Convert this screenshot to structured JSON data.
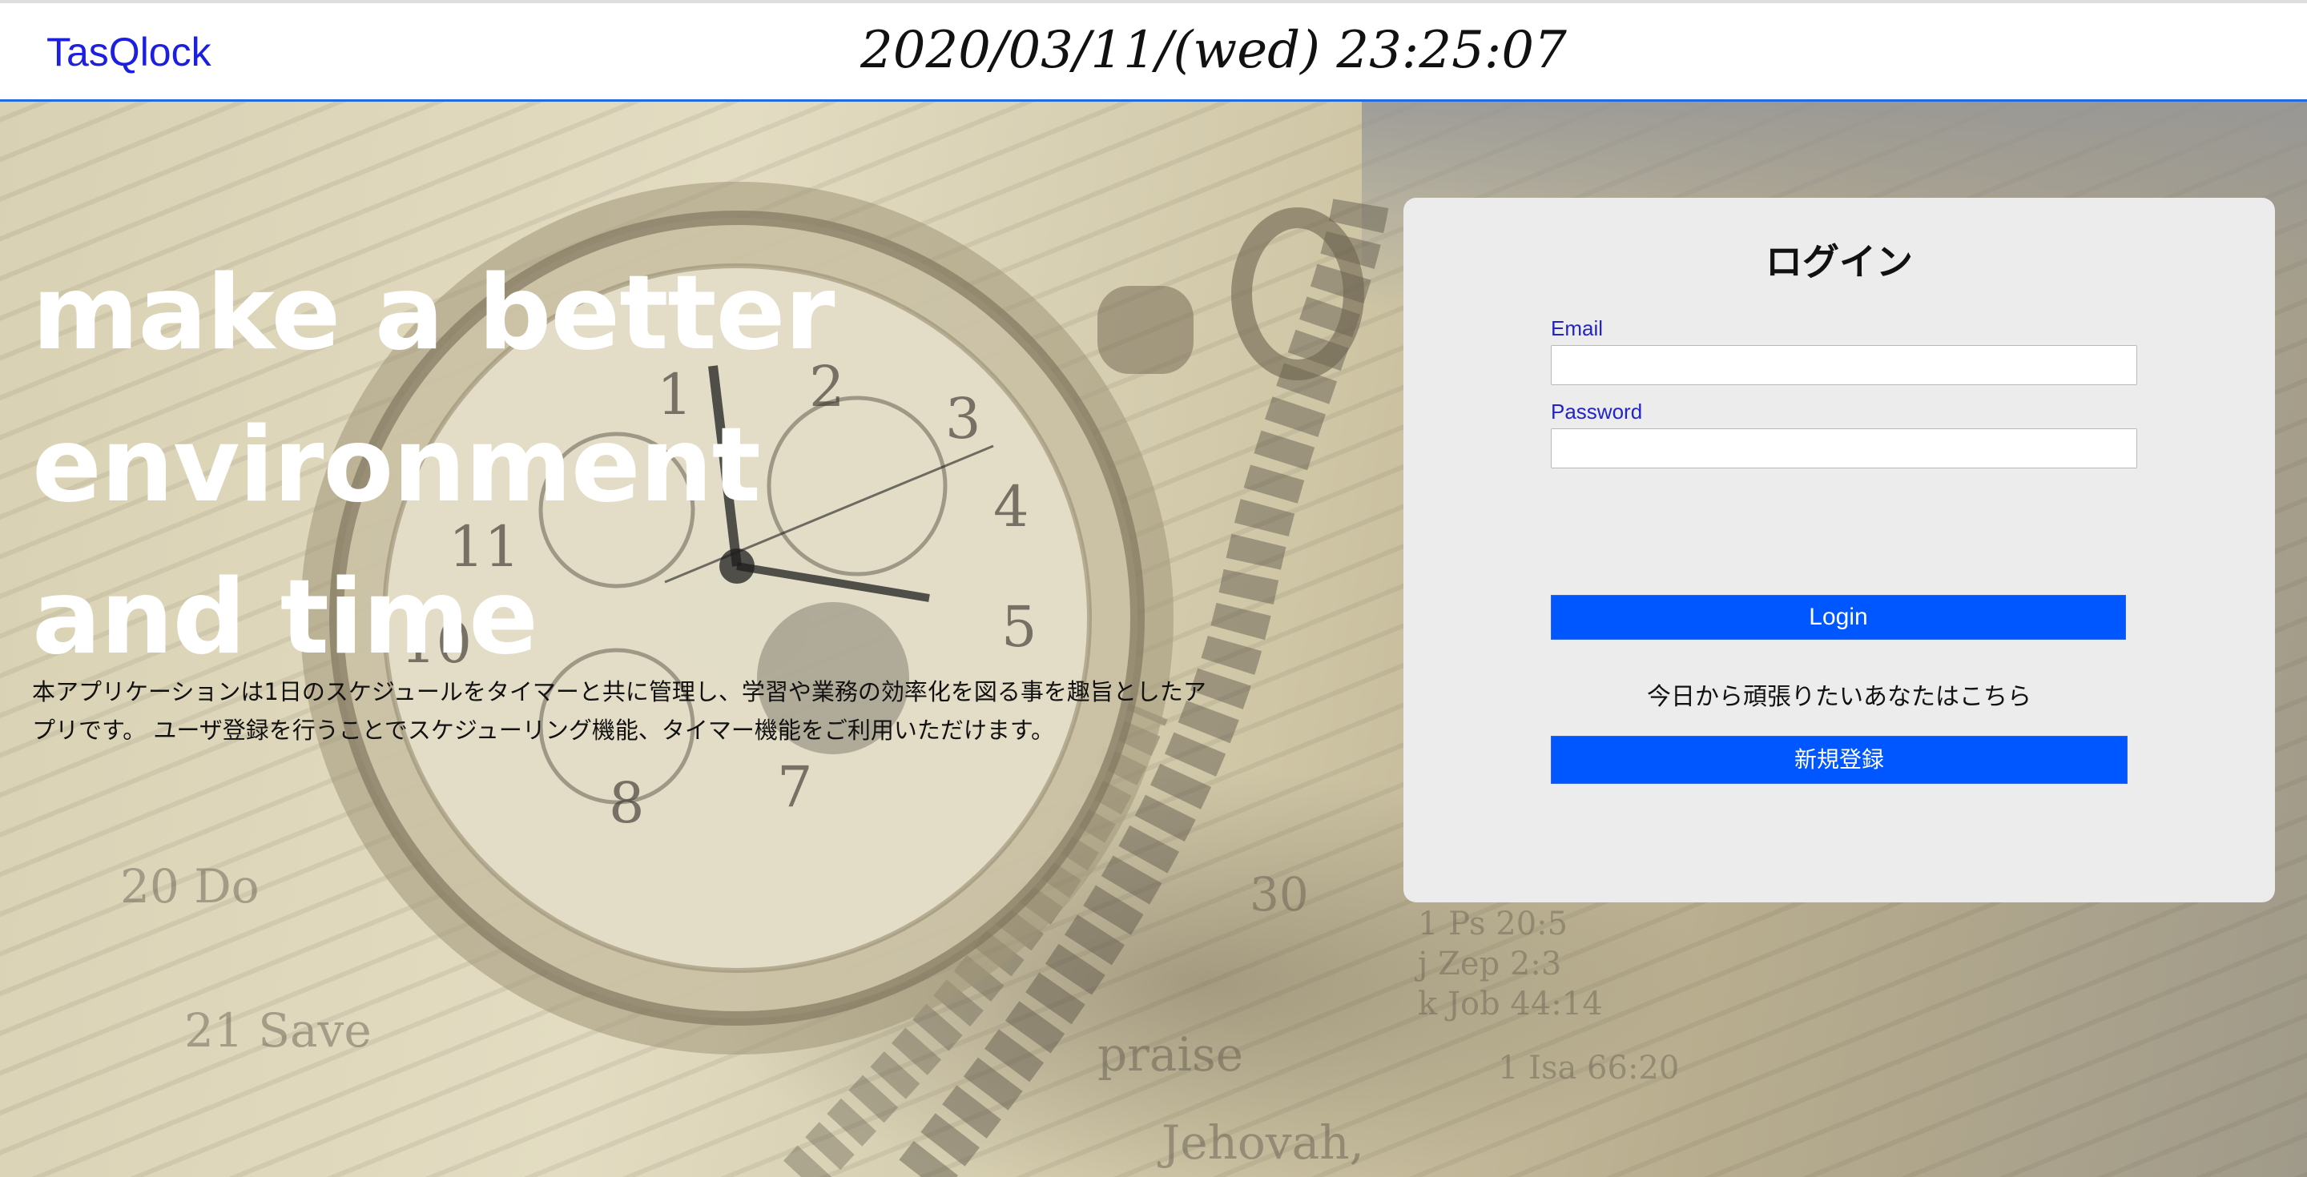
{
  "header": {
    "brand": "TasQlock",
    "clock": "2020/03/11/(wed) 23:25:07"
  },
  "hero": {
    "headline_lines": [
      "make a better",
      "environment",
      "and time"
    ],
    "description_lines": [
      "本アプリケーションは1日のスケジュールをタイマーと共に管理し、学習や業務の効率化を図る事を趣旨としたア",
      "プリです。 ユーザ登録を行うことでスケジューリング機能、タイマー機能をご利用いただけます。"
    ]
  },
  "login": {
    "title": "ログイン",
    "email_label": "Email",
    "email_value": "",
    "password_label": "Password",
    "password_value": "",
    "login_button": "Login",
    "signup_prompt": "今日から頑張りたいあなたはこちら",
    "signup_button": "新規登録"
  },
  "colors": {
    "brand": "#1c1fe0",
    "accent_line": "#1f6bdf",
    "button": "#0056ff",
    "card_bg": "#ececec",
    "label": "#2323c8"
  }
}
